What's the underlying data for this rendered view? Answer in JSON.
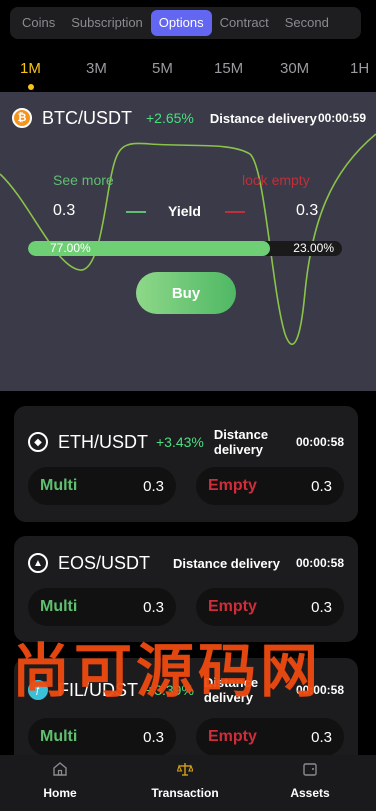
{
  "top_tabs": [
    "Coins",
    "Subscription",
    "Options",
    "Contract",
    "Second"
  ],
  "active_top_tab": "Options",
  "timeframes": [
    "1M",
    "3M",
    "5M",
    "15M",
    "30M",
    "1H"
  ],
  "active_timeframe": "1M",
  "featured": {
    "pair": "BTC/USDT",
    "change": "+2.65%",
    "distance_label": "Distance delivery",
    "timer": "00:00:59",
    "see_more": "See more",
    "look_empty": "look empty",
    "left_value": "0.3",
    "right_value": "0.3",
    "yield_label": "Yield",
    "progress_left": "77.00%",
    "progress_right": "23.00%",
    "progress_fraction": 0.77,
    "buy_label": "Buy"
  },
  "cards": [
    {
      "pair": "ETH/USDT",
      "change": "+3.43%",
      "distance_label": "Distance delivery",
      "timer": "00:00:58",
      "multi_label": "Multi",
      "multi_value": "0.3",
      "empty_label": "Empty",
      "empty_value": "0.3"
    },
    {
      "pair": "EOS/USDT",
      "change": "",
      "distance_label": "Distance delivery",
      "timer": "00:00:58",
      "multi_label": "Multi",
      "multi_value": "0.3",
      "empty_label": "Empty",
      "empty_value": "0.3"
    },
    {
      "pair": "FIL/UDST",
      "change": "+3.39%",
      "distance_label": "Distance delivery",
      "timer": "00:00:58",
      "multi_label": "Multi",
      "multi_value": "0.3",
      "empty_label": "Empty",
      "empty_value": "0.3"
    }
  ],
  "watermark": "尚可源码网",
  "bottom_nav": [
    "Home",
    "Transaction",
    "Assets"
  ],
  "colors": {
    "accent": "#6366f1",
    "gold": "#f5c518",
    "green": "#5fbf70",
    "red": "#d02d3a",
    "panel": "#3a3a48"
  }
}
